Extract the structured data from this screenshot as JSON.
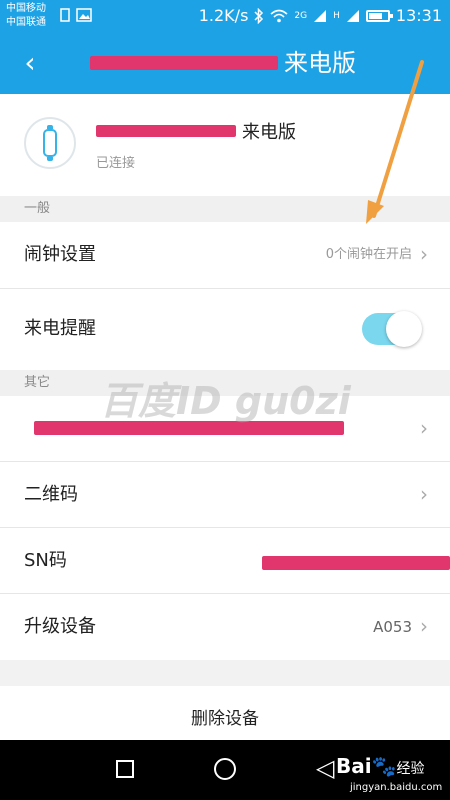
{
  "status_bar": {
    "carrier_1": "中国移动",
    "carrier_2": "中国联通",
    "speed": "1.2K/s",
    "net_2g": "2G",
    "net_h": "H",
    "time": "13:31"
  },
  "app_bar": {
    "back_icon": "‹",
    "title_suffix": "来电版"
  },
  "device": {
    "name_suffix": "来电版",
    "status": "已连接"
  },
  "sections": {
    "general": "一般",
    "other": "其它"
  },
  "rows": {
    "alarm_label": "闹钟设置",
    "alarm_value": "0个闹钟在开启",
    "call_reminder_label": "来电提醒",
    "call_reminder_on": true,
    "qr_label": "二维码",
    "sn_label": "SN码",
    "upgrade_label": "升级设备",
    "upgrade_value": "A053",
    "delete_label": "删除设备"
  },
  "chevron": "›",
  "watermark": "百度ID gu0zi",
  "baidu": {
    "logo": "Bai",
    "logo_tail": "经验",
    "url": "jingyan.baidu.com"
  },
  "colors": {
    "primary": "#1ea2e6",
    "redaction": "#e0356d",
    "toggle_on": "#7ad7ee",
    "arrow": "#f0a040"
  }
}
